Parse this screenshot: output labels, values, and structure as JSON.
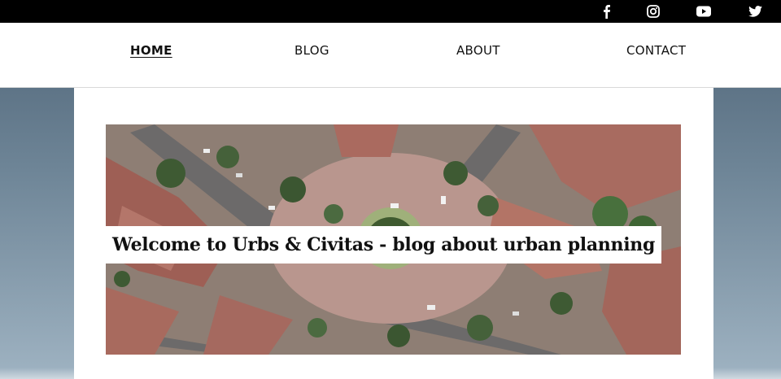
{
  "social": {
    "facebook": "facebook-icon",
    "instagram": "instagram-icon",
    "youtube": "youtube-icon",
    "twitter": "twitter-icon"
  },
  "nav": {
    "items": [
      {
        "label": "HOME"
      },
      {
        "label": "BLOG"
      },
      {
        "label": "ABOUT"
      },
      {
        "label": "CONTACT"
      }
    ]
  },
  "hero": {
    "title": "Welcome to Urbs & Civitas - blog about urban planning",
    "image": "aerial-roundabout-photo"
  },
  "colors": {
    "topbar": "#000000",
    "nav_bg": "#ffffff",
    "page_bg": "#6e8597"
  }
}
